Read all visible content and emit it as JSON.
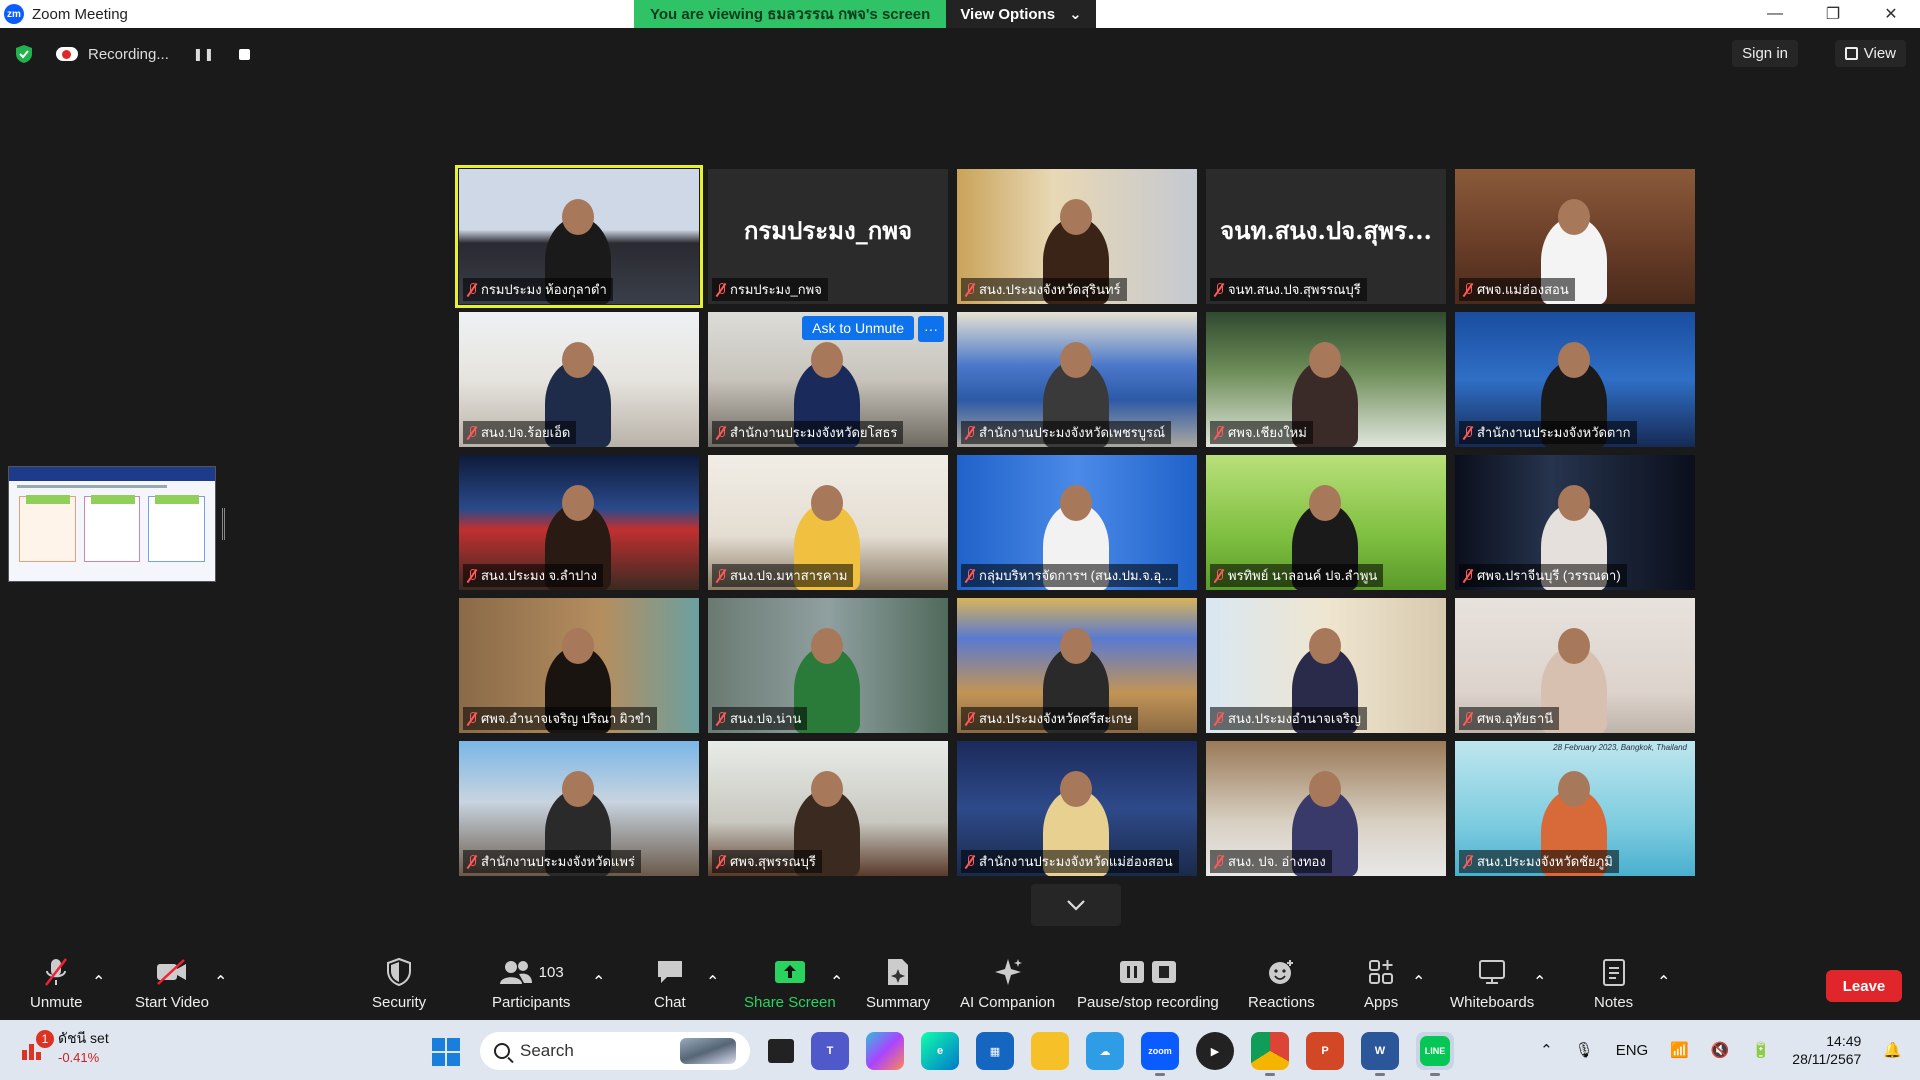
{
  "window": {
    "title": "Zoom Meeting",
    "logo_text": "zm",
    "banner_text": "You are viewing ธมลวรรณ กพจ's screen",
    "view_options_label": "View Options"
  },
  "status": {
    "recording_label": "Recording...",
    "sign_in_label": "Sign in",
    "view_label": "View"
  },
  "tiles": [
    {
      "name": "กรมประมง ห้องกุลาดำ",
      "scene": "meeting"
    },
    {
      "name": "กรมประมง_กพจ",
      "scene": "namecard",
      "big_name": "กรมประมง_กพจ"
    },
    {
      "name": "สนง.ประมงจังหวัดสุรินทร์",
      "scene": "woman-phone"
    },
    {
      "name": "จนท.สนง.ปจ.สุพรรณบุรี",
      "scene": "namecard",
      "big_name": "จนท.สนง.ปจ.สุพร..."
    },
    {
      "name": "ศพจ.แม่ฮ่องสอน",
      "scene": "conference-room"
    },
    {
      "name": "สนง.ปจ.ร้อยเอ็ด",
      "scene": "office-group"
    },
    {
      "name": "สำนักงานประมงจังหวัดยโสธร",
      "scene": "office-group2",
      "ask_unmute": "Ask to Unmute"
    },
    {
      "name": "สำนักงานประมงจังหวัดเพชรบูรณ์",
      "scene": "banner-group"
    },
    {
      "name": "ศพจ.เชียงใหม่",
      "scene": "forest"
    },
    {
      "name": "สำนักงานประมงจังหวัดตาก",
      "scene": "blue-room"
    },
    {
      "name": "สนง.ประมง จ.ลำปาง",
      "scene": "night-banner"
    },
    {
      "name": "สนง.ปจ.มหาสารคาม",
      "scene": "office-desk"
    },
    {
      "name": "กลุ่มบริหารจัดการฯ (สนง.ปม.จ.อุ...",
      "scene": "blue-curtain"
    },
    {
      "name": "พรทิพย์ นาลอนค์ ปจ.ลำพูน",
      "scene": "grass"
    },
    {
      "name": "ศพจ.ปราจีนบุรี (วรรณดา)",
      "scene": "dark-curtain"
    },
    {
      "name": "ศพจ.อำนาจเจริญ ปริณา ผิวขำ",
      "scene": "woman-window"
    },
    {
      "name": "สนง.ปจ.น่าน",
      "scene": "green-shirt"
    },
    {
      "name": "สนง.ประมงจังหวัดศรีสะเกษ",
      "scene": "banner-man"
    },
    {
      "name": "สนง.ประมงอำนาจเจริญ",
      "scene": "maps-room"
    },
    {
      "name": "ศพจ.อุทัยธานี",
      "scene": "empty-wall"
    },
    {
      "name": "สำนักงานประมงจังหวัดแพร่",
      "scene": "banner-man2"
    },
    {
      "name": "ศพจ.สุพรรณบุรี",
      "scene": "closeup"
    },
    {
      "name": "สำนักงานประมงจังหวัดแม่ฮ่องสอน",
      "scene": "shelves"
    },
    {
      "name": "สนง. ปจ. อ่างทอง",
      "scene": "big-room"
    },
    {
      "name": "สนง.ประมงจังหวัดชัยภูมิ",
      "scene": "blue-bg",
      "caption": "28 February 2023, Bangkok, Thailand"
    }
  ],
  "toolbar": {
    "unmute": "Unmute",
    "start_video": "Start Video",
    "security": "Security",
    "participants": "Participants",
    "participants_count": "103",
    "chat": "Chat",
    "share_screen": "Share Screen",
    "summary": "Summary",
    "ai_companion": "AI Companion",
    "pause_recording": "Pause/stop recording",
    "reactions": "Reactions",
    "apps": "Apps",
    "whiteboards": "Whiteboards",
    "notes": "Notes",
    "leave": "Leave"
  },
  "taskbar": {
    "stock_name": "ดัชนี set",
    "stock_change": "-0.41%",
    "stock_badge": "1",
    "search_placeholder": "Search",
    "language": "ENG",
    "time": "14:49",
    "date": "28/11/2567"
  },
  "colors": {
    "banner_green": "#2fc266",
    "share_green": "#2ad35f",
    "leave_red": "#e0262b",
    "active_speaker": "#e8f22a",
    "zoom_blue": "#0e72ed"
  }
}
